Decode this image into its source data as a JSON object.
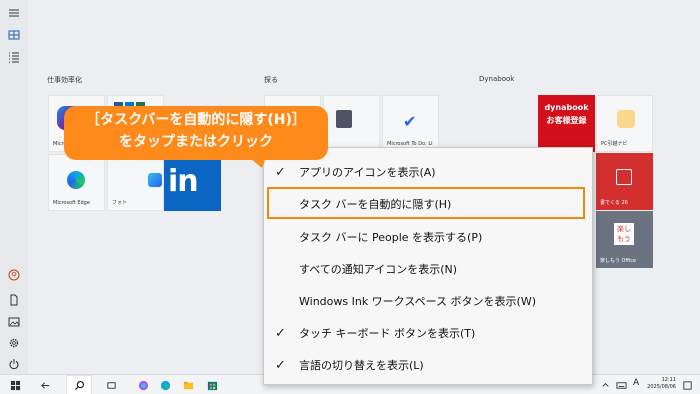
{
  "start_menu": {
    "groups": [
      "仕事効率化",
      "探る",
      "Dynabook"
    ],
    "tiles": {
      "microsoft_365": "Micros",
      "edge": "Microsoft Edge",
      "photos": "フォト",
      "todo": "Microsoft To Do: Li",
      "dynabook_title": "dynabook",
      "dynabook_sub": "お客様登録",
      "pc_kiribuki": "PC引越ナビ",
      "sticky": "書でくる 26",
      "tanoshiu_badge": "楽し もう",
      "tanoshiu_caption": "楽しもう Office"
    }
  },
  "context_menu": {
    "items": [
      {
        "label": "アプリのアイコンを表示(A)",
        "checked": true
      },
      {
        "label": "タスク バーを自動的に隠す(H)",
        "checked": false
      },
      {
        "label": "タスク バーに People を表示する(P)",
        "checked": false
      },
      {
        "label": "すべての通知アイコンを表示(N)",
        "checked": false
      },
      {
        "label": "Windows Ink ワークスペース ボタンを表示(W)",
        "checked": false
      },
      {
        "label": "タッチ キーボード ボタンを表示(T)",
        "checked": true
      },
      {
        "label": "言語の切り替えを表示(L)",
        "checked": true
      }
    ],
    "check_glyph": "✓",
    "highlight_color": "#f0890c"
  },
  "callout": {
    "line1": "［タスクバーを自動的に隠す(H)］",
    "line2": "をタップまたはクリック",
    "color": "#ff8a1c"
  },
  "taskbar": {
    "ime": "A",
    "time": "12:11",
    "date": "2025/08/06"
  },
  "rail_icons": [
    "hamburger-icon",
    "tiles-icon",
    "list-icon",
    "user-icon",
    "document-icon",
    "pictures-icon",
    "settings-icon",
    "power-icon"
  ]
}
